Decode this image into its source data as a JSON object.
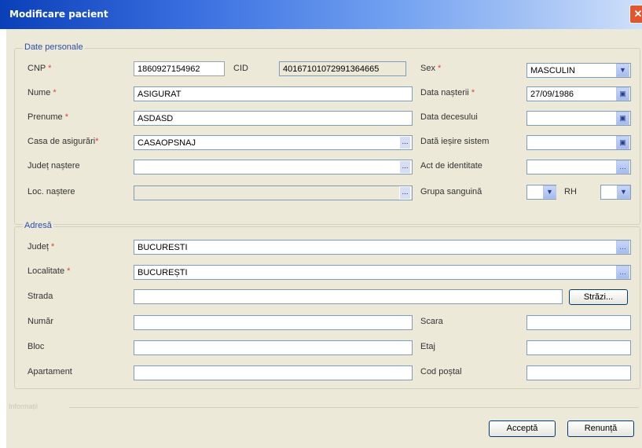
{
  "window": {
    "title": "Modificare pacient",
    "close_glyph": "✕"
  },
  "personal": {
    "legend": "Date personale",
    "cnp_label": "CNP",
    "cnp_value": "1860927154962",
    "cid_label": "CID",
    "cid_value": "40167101072991364665",
    "nume_label": "Nume",
    "nume_value": "ASIGURAT",
    "prenume_label": "Prenume",
    "prenume_value": "ASDASD",
    "casa_label": "Casa de asigurări",
    "casa_value": "CASAOPSNAJ",
    "judet_nastere_label": "Județ naștere",
    "judet_nastere_value": "",
    "loc_nastere_label": "Loc. naștere",
    "loc_nastere_value": "",
    "sex_label": "Sex",
    "sex_value": "MASCULIN",
    "data_nasterii_label": "Data nașterii",
    "data_nasterii_value": "27/09/1986",
    "data_decesului_label": "Data decesului",
    "data_decesului_value": "",
    "data_iesire_label": "Dată ieșire sistem",
    "data_iesire_value": "",
    "act_label": "Act de identitate",
    "act_value": "",
    "grupa_label": "Grupa sanguină",
    "grupa_value": "",
    "rh_label": "RH",
    "rh_value": ""
  },
  "address": {
    "legend": "Adresă",
    "judet_label": "Județ",
    "judet_value": "BUCURESTI",
    "localitate_label": "Localitate",
    "localitate_value": "BUCUREȘTI",
    "strada_label": "Strada",
    "strada_value": "",
    "strazi_button": "Străzi...",
    "numar_label": "Număr",
    "numar_value": "",
    "scara_label": "Scara",
    "scara_value": "",
    "bloc_label": "Bloc",
    "bloc_value": "",
    "etaj_label": "Etaj",
    "etaj_value": "",
    "apartament_label": "Apartament",
    "apartament_value": "",
    "cod_postal_label": "Cod poștal",
    "cod_postal_value": ""
  },
  "footer": {
    "faint_label": "Informații",
    "accept_button": "Acceptă",
    "cancel_button": "Renunță"
  },
  "required_mark": "*",
  "icons": {
    "ellipsis": "...",
    "dropdown": "▼",
    "calendar": "▣",
    "lookup": "…"
  }
}
